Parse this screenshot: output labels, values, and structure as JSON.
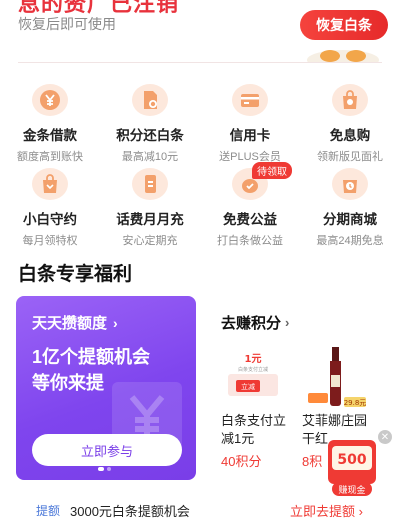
{
  "header": {
    "title": "息的赘广已注销",
    "subtitle": "恢复后即可使用",
    "restore_button": "恢复白条"
  },
  "services": [
    {
      "label": "金条借款",
      "sub": "额度高到账快",
      "icon": "yen-coin-icon"
    },
    {
      "label": "积分还白条",
      "sub": "最高减10元",
      "icon": "points-document-icon"
    },
    {
      "label": "信用卡",
      "sub": "送PLUS会员",
      "icon": "credit-card-icon"
    },
    {
      "label": "免息购",
      "sub": "领新版见面礼",
      "icon": "interest-free-bag-icon"
    },
    {
      "label": "小白守约",
      "sub": "每月领特权",
      "icon": "shopping-bag-icon"
    },
    {
      "label": "话费月月充",
      "sub": "安心定期充",
      "icon": "phone-topup-icon"
    },
    {
      "label": "免费公益",
      "sub": "打白条做公益",
      "icon": "charity-pot-icon",
      "badge": "待领取"
    },
    {
      "label": "分期商城",
      "sub": "最高24期免息",
      "icon": "installment-mall-icon"
    }
  ],
  "section_title": "白条专享福利",
  "promo": {
    "header": "天天攒额度",
    "headline_line1": "1亿个提额机会",
    "headline_line2": "等你来提",
    "button": "立即参与"
  },
  "earn": {
    "title": "去赚积分",
    "items": [
      {
        "name_line1": "白条支付立",
        "name_line2": "减1元",
        "points": "40积分",
        "img_text_top": "1元",
        "img_text_mid": "白条支付立减",
        "img_text_tag": "立减"
      },
      {
        "name_line1": "艾菲娜庄园",
        "name_line2": "干红",
        "points": "8积",
        "price_tag": "29.8元"
      }
    ]
  },
  "floating": {
    "amount": "500",
    "label": "赚现金"
  },
  "bottom": {
    "tag": "提额",
    "text": "3000元白条提额机会",
    "link": "立即去提额"
  },
  "colors": {
    "accent": "#ef3a34",
    "purple": "#7f45ee",
    "icon_bg": "#fde8dc",
    "icon_fg": "#f08a4b"
  }
}
